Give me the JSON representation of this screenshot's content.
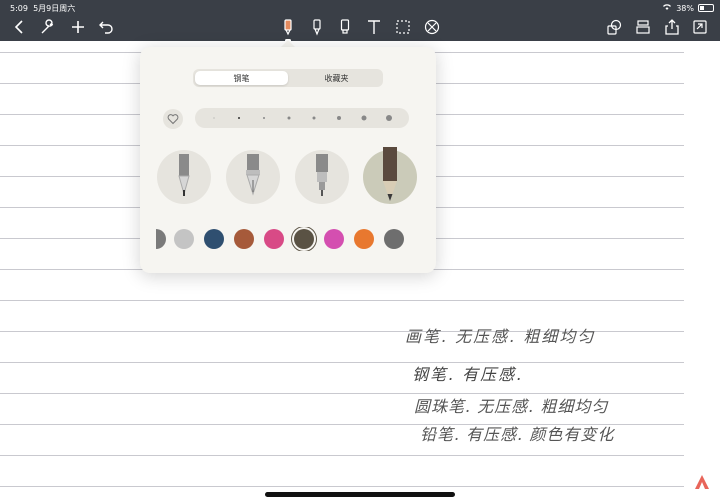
{
  "status": {
    "time": "5:09",
    "date": "5月9日周六",
    "battery": "38%"
  },
  "toolbar": {
    "left_icons": [
      "back-chevron-icon",
      "wrench-icon",
      "plus-icon",
      "undo-icon"
    ],
    "tools": [
      "pen-tool-icon",
      "highlighter-tool-icon",
      "marker-tool-icon",
      "text-tool-icon",
      "lasso-tool-icon",
      "eraser-tool-icon"
    ],
    "right_icons": [
      "shapes-icon",
      "layers-icon",
      "share-icon",
      "export-icon"
    ]
  },
  "popover": {
    "tabs": [
      {
        "label": "钢笔",
        "active": true
      },
      {
        "label": "收藏夹",
        "active": false
      }
    ],
    "pen_types": [
      "ballpoint-pen-icon",
      "fountain-pen-icon",
      "brush-pen-icon",
      "pencil-icon"
    ],
    "colors": [
      "#7a7a7a",
      "#c4c4c4",
      "#2f4f70",
      "#a65a3a",
      "#d84a86",
      "#5a5244",
      "#d44fb0",
      "#e8782f",
      "#6e6e6e"
    ],
    "selected_color": "#5a5244"
  },
  "notes": {
    "line1": "画笔.  无压感. 粗细均匀",
    "line2": "钢笔.  有压感.",
    "line3": "圆珠笔.  无压感.  粗细均匀",
    "line4": "铅笔.  有压感.  颜色有变化"
  }
}
